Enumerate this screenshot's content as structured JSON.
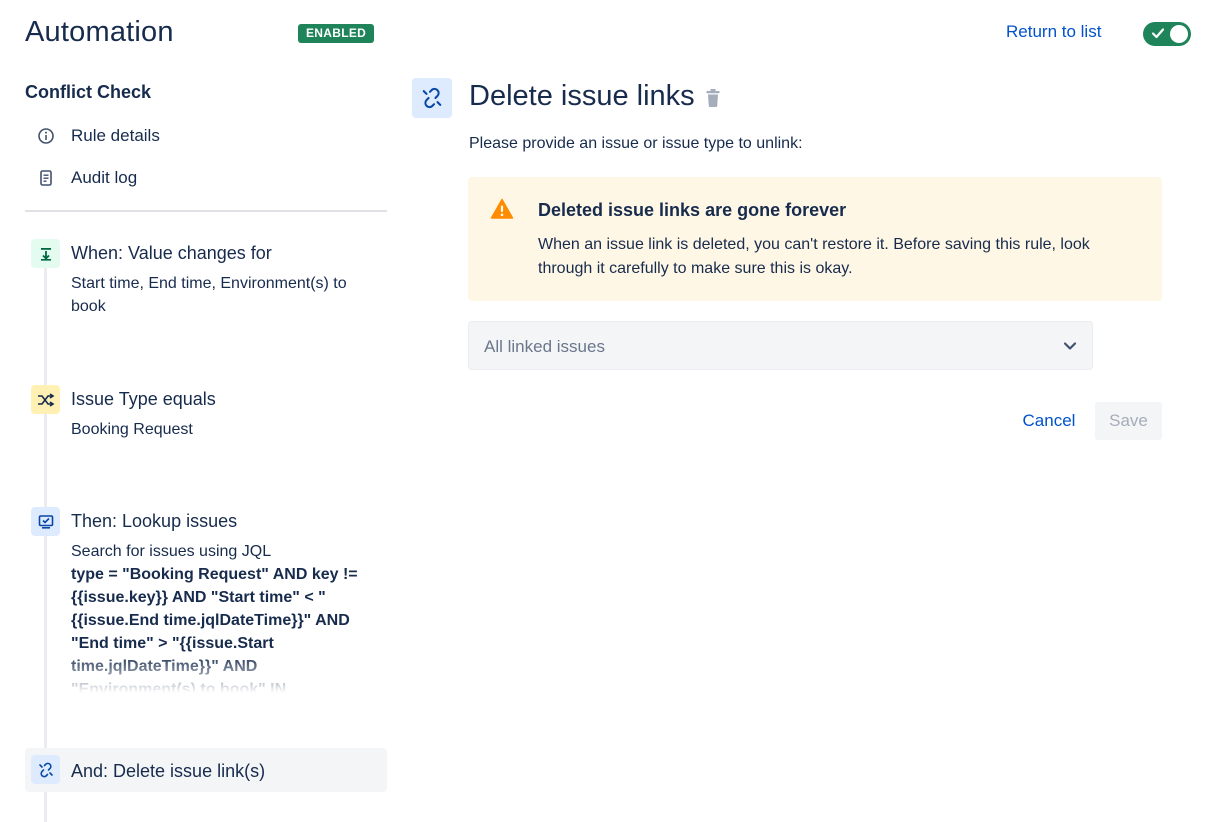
{
  "header": {
    "title": "Automation",
    "status_badge": "ENABLED",
    "return_link": "Return to list"
  },
  "sidebar": {
    "rule_name": "Conflict Check",
    "links": [
      {
        "label": "Rule details",
        "icon": "info-icon"
      },
      {
        "label": "Audit log",
        "icon": "document-icon"
      }
    ],
    "steps": [
      {
        "title": "When: Value changes for",
        "description": "Start time, End time, Environment(s) to book",
        "icon": "trigger-icon",
        "color": "#e3fcef"
      },
      {
        "title": "Issue Type equals",
        "description": "Booking Request",
        "icon": "shuffle-icon",
        "color": "#fff0b3"
      },
      {
        "title": "Then: Lookup issues",
        "description": "Search for issues using JQL",
        "query": "type = \"Booking Request\" AND key != {{issue.key}} AND \"Start time\" < \"{{issue.End time.jqlDateTime}}\" AND \"End time\" > \"{{issue.Start time.jqlDateTime}}\" AND \"Environment(s) to book\" IN",
        "icon": "monitor-icon",
        "color": "#deebff"
      },
      {
        "title": "And: Delete issue link(s)",
        "icon": "unlink-icon",
        "color": "#deebff"
      }
    ]
  },
  "main": {
    "title": "Delete issue links",
    "instruction": "Please provide an issue or issue type to unlink:",
    "warning": {
      "title": "Deleted issue links are gone forever",
      "body": "When an issue link is deleted, you can't restore it. Before saving this rule, look through it carefully to make sure this is okay."
    },
    "select": {
      "value": "All linked issues"
    },
    "cancel_label": "Cancel",
    "save_label": "Save"
  },
  "colors": {
    "accent": "#0052cc",
    "success": "#1f845a",
    "warning_bg": "#fff7e6",
    "warning_icon": "#ff8b00"
  }
}
